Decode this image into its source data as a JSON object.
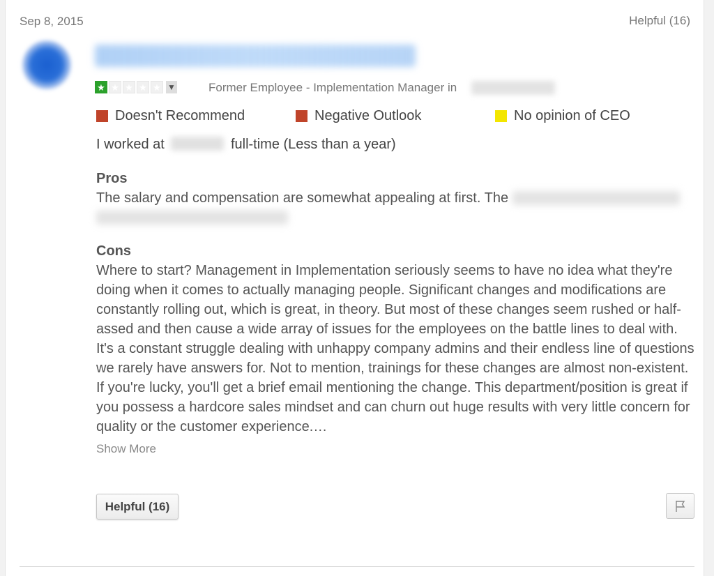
{
  "review": {
    "date": "Sep 8, 2015",
    "helpful_count_label": "Helpful (16)",
    "rating": {
      "value": 1,
      "max": 5
    },
    "reviewer_status": "Former Employee - Implementation Manager in",
    "flags": [
      {
        "label": "Doesn't Recommend",
        "color": "#c0442a"
      },
      {
        "label": "Negative Outlook",
        "color": "#c0442a"
      },
      {
        "label": "No opinion of CEO",
        "color": "#f3e600"
      }
    ],
    "employment": {
      "prefix": "I worked at",
      "suffix": "full-time (Less than a year)"
    },
    "pros": {
      "title": "Pros",
      "text": "The salary and compensation are somewhat appealing at first. The"
    },
    "cons": {
      "title": "Cons",
      "text": "Where to start? Management in Implementation seriously seems to have no idea what they're doing when it comes to actually managing people. Significant changes and modifications are constantly rolling out, which is great, in theory. But most of these changes seem rushed or half-assed and then cause a wide array of issues for the employees on the battle lines to deal with. It's a constant struggle dealing with unhappy company admins and their endless line of questions we rarely have answers for. Not to mention, trainings for these changes are almost non-existent. If you're lucky, you'll get a brief email mentioning the change. This department/position is great if you possess a hardcore sales mindset and can churn out huge results with very little concern for quality or the customer experience.…"
    },
    "show_more_label": "Show More",
    "helpful_button_label": "Helpful (16)",
    "icons": {
      "star": "star-icon",
      "caret": "caret-down-icon",
      "flag": "flag-icon"
    }
  }
}
